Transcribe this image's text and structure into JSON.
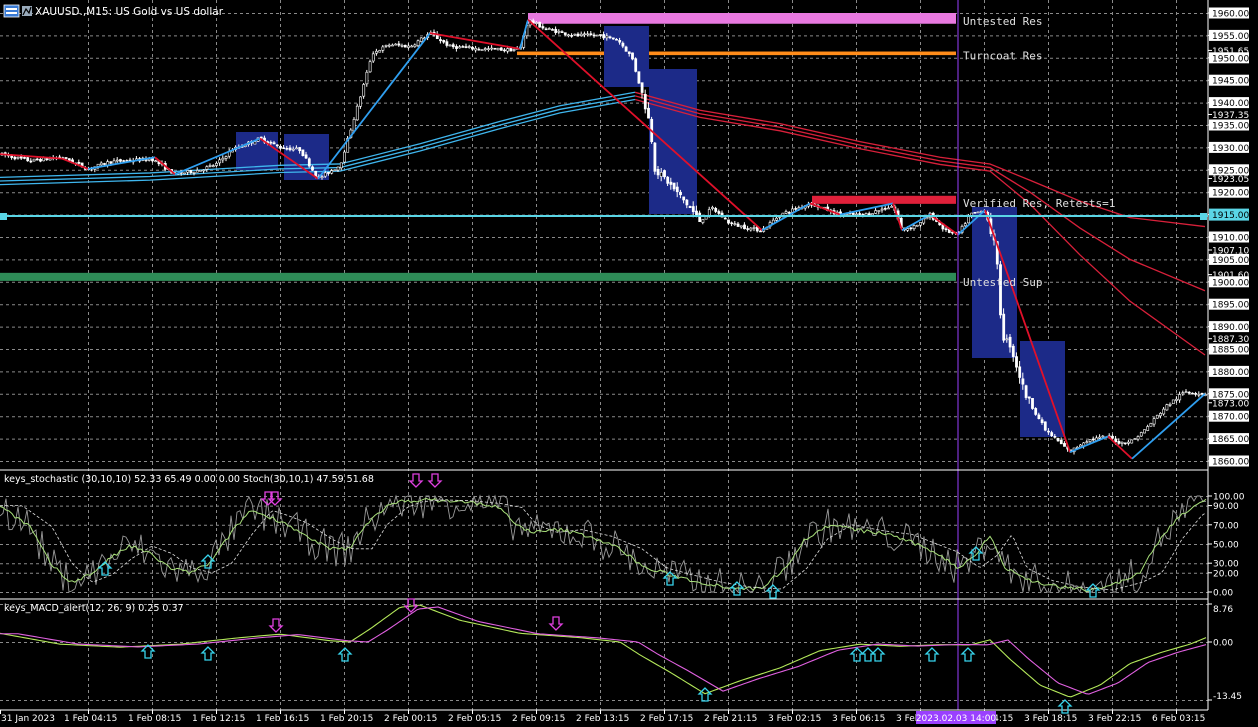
{
  "window": {
    "title": "XAUUSD.,M15:  US Gold vs US dollar",
    "symbol": "XAUUSD.",
    "timeframe": "M15"
  },
  "icons": {
    "chart_icon": "chart-window-icon",
    "buy_arrow": "up-arrow-icon",
    "sell_arrow": "down-arrow-icon"
  },
  "colors": {
    "bg": "#000000",
    "grid": "#8a8a8a",
    "bull": "#ffffff",
    "bear": "#ffffff",
    "zigzag_up": "#2f9ff0",
    "zigzag_down": "#e0102a",
    "ma_blue": "#3fb6ee",
    "ma_red": "#d8203a",
    "zone_untested_res": "#e879e0",
    "zone_turncoat": "#ff8c1a",
    "zone_verified": "#e0203a",
    "zone_sup": "#2e8b57",
    "price_line": "#5ad6e6",
    "box": "#1c2a88",
    "stoch_main": "#bfbfbf",
    "stoch_signal": "#a8e07a",
    "macd_main": "#b4e85a",
    "macd_signal": "#e060e0",
    "cyan_arrow": "#37d4ec",
    "magenta_arrow": "#e040e0",
    "vline": "#9a40ff"
  },
  "price_axis": {
    "labels": [
      "1960.00",
      "1955.00",
      "1951.65",
      "1950.00",
      "1945.00",
      "1940.00",
      "1937.35",
      "1935.00",
      "1930.00",
      "1925.00",
      "1923.05",
      "1920.00",
      "1915.00",
      "1910.00",
      "1907.10",
      "1905.00",
      "1901.60",
      "1900.00",
      "1895.00",
      "1890.00",
      "1887.30",
      "1885.00",
      "1880.00",
      "1875.00",
      "1873.00",
      "1870.00",
      "1865.00",
      "1860.00"
    ],
    "highlight": [
      "1960.00",
      "1955.00",
      "1950.00",
      "1945.00",
      "1940.00",
      "1935.00",
      "1930.00",
      "1925.00",
      "1920.00",
      "1915.00",
      "1910.00",
      "1905.00",
      "1900.00",
      "1895.00",
      "1890.00",
      "1885.00",
      "1880.00",
      "1875.00",
      "1870.00",
      "1865.00",
      "1860.00"
    ],
    "range": [
      1859,
      1962
    ]
  },
  "time_axis": {
    "labels": [
      "31 Jan 2023",
      "1 Feb 04:15",
      "1 Feb 08:15",
      "1 Feb 12:15",
      "1 Feb 16:15",
      "1 Feb 20:15",
      "2 Feb 00:15",
      "2 Feb 05:15",
      "2 Feb 09:15",
      "2 Feb 13:15",
      "2 Feb 17:15",
      "2 Feb 21:15",
      "3 Feb 02:15",
      "3 Feb 06:15",
      "3 Feb 10:15",
      "3 Feb 14:15",
      "3 Feb 18:15",
      "3 Feb 22:15",
      "6 Feb 03:15"
    ],
    "cursor_label": "2023.02.03 14:00"
  },
  "zones": [
    {
      "name": "Untested Res",
      "label": "Untested Res",
      "top": 1960,
      "bottom": 1957.6
    },
    {
      "name": "Turncoat Res",
      "label": "Turncoat Res",
      "top": 1951.4,
      "bottom": 1950.6
    },
    {
      "name": "Verified Res",
      "label": "Verified Res, Retests=1",
      "top": 1919.2,
      "bottom": 1917.4
    },
    {
      "name": "Untested Sup",
      "label": "Untested Sup",
      "top": 1902.0,
      "bottom": 1900.2
    }
  ],
  "current_price": "1915.00",
  "stochastic": {
    "title": "keys_stochastic (30,10,10) 52.33 65.49 0.00 0.00 Stoch(30,10,1) 47.59 51.68",
    "levels": [
      "100.00",
      "90.00",
      "70.00",
      "50.00",
      "30.00",
      "20.00",
      "0.00"
    ]
  },
  "macd": {
    "title": "keys_MACD_alert(12, 26, 9) 0.25 0.37",
    "levels": [
      "8.76",
      "0.00",
      "-13.45"
    ]
  },
  "chart_data": {
    "type": "line",
    "title": "XAUUSD.,M15:  US Gold vs US dollar",
    "x": [
      "31 Jan 2023",
      "1 Feb 04:15",
      "1 Feb 08:15",
      "1 Feb 12:15",
      "1 Feb 16:15",
      "1 Feb 20:15",
      "2 Feb 00:15",
      "2 Feb 05:15",
      "2 Feb 09:15",
      "2 Feb 13:15",
      "2 Feb 17:15",
      "2 Feb 21:15",
      "3 Feb 02:15",
      "3 Feb 06:15",
      "3 Feb 10:15",
      "3 Feb 14:15",
      "3 Feb 18:15",
      "3 Feb 22:15",
      "6 Feb 03:15"
    ],
    "series": [
      {
        "values": [
          1928.5,
          1927.5,
          1925.5,
          1925.8,
          1931.5,
          1924.5,
          1955.5,
          1953.0,
          1957.0,
          1948.0,
          1918.0,
          1912.0,
          1916.5,
          1914.5,
          1912.0,
          1915.0,
          1865.5,
          1866.0,
          1875.0
        ]
      }
    ],
    "ylim": [
      1859,
      1962
    ],
    "grid": true
  }
}
